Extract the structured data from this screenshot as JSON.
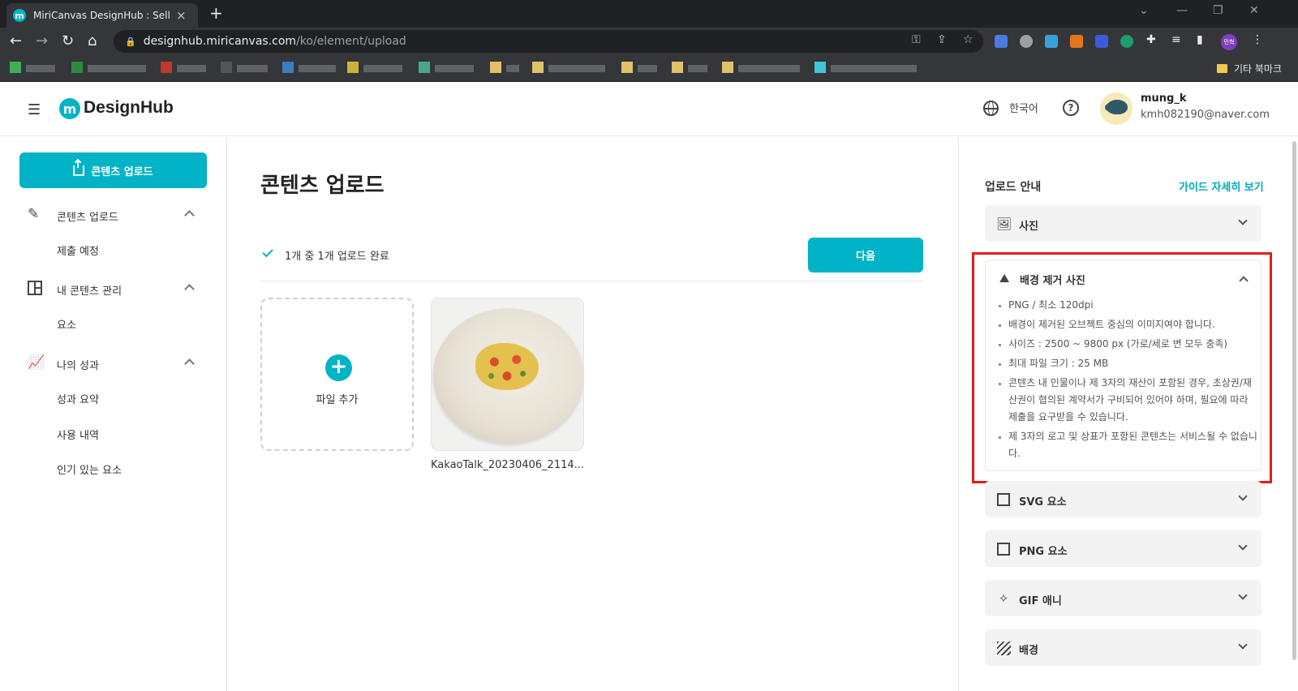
{
  "browser": {
    "tab_title": "MiriCanvas DesignHub : Sell your",
    "favicon_letter": "m",
    "url_host": "designhub.miricanvas.com",
    "url_path": "/ko/element/upload",
    "profile_label": "민혁",
    "other_bookmarks": "기타 북마크"
  },
  "header": {
    "logo_letter": "m",
    "logo_text": "DesignHub",
    "language": "한국어",
    "help": "?",
    "user_name": "mung_k",
    "user_email": "kmh082190@naver.com"
  },
  "sidebar": {
    "upload_button": "콘텐츠 업로드",
    "sections": [
      {
        "label": "콘텐츠 업로드",
        "icon": "pencil-icon",
        "items": [
          "제출 예정"
        ]
      },
      {
        "label": "내 콘텐츠 관리",
        "icon": "layout-icon",
        "items": [
          "요소"
        ]
      },
      {
        "label": "나의 성과",
        "icon": "chart-icon",
        "items": [
          "성과 요약",
          "사용 내역",
          "인기 있는 요소"
        ]
      }
    ]
  },
  "main": {
    "title": "콘텐츠 업로드",
    "status": "1개 중 1개 업로드 완료",
    "next_button": "다음",
    "add_file_label": "파일 추가",
    "file_name": "KakaoTalk_20230406_2114..."
  },
  "guide": {
    "title": "업로드 안내",
    "link": "가이드 자세히 보기",
    "sections": [
      {
        "label": "사진",
        "icon": "image-icon",
        "expanded": false
      },
      {
        "label": "배경 제거 사진",
        "icon": "mountain-icon",
        "expanded": true,
        "rules": [
          "PNG / 최소 120dpi",
          "배경이 제거된 오브젝트 중심의 이미지여야 합니다.",
          "사이즈 : 2500 ~ 9800 px (가로/세로 변 모두 충족)",
          "최대 파일 크기 : 25 MB",
          "콘텐츠 내 인물이나 제 3자의 재산이 포함된 경우, 초상권/재산권이 협의된 계약서가 구비되어 있어야 하며, 필요에 따라 제출을 요구받을 수 있습니다.",
          "제 3자의 로고 및 상표가 포함된 콘텐츠는 서비스될 수 없습니다."
        ]
      },
      {
        "label": "SVG 요소",
        "icon": "svg-frame-icon",
        "expanded": false
      },
      {
        "label": "PNG 요소",
        "icon": "png-frame-icon",
        "expanded": false
      },
      {
        "label": "GIF 애니",
        "icon": "sparkle-icon",
        "expanded": false
      },
      {
        "label": "배경",
        "icon": "hatch-icon",
        "expanded": false
      }
    ]
  },
  "colors": {
    "accent": "#00b3c6",
    "highlight": "#e41c1c"
  }
}
